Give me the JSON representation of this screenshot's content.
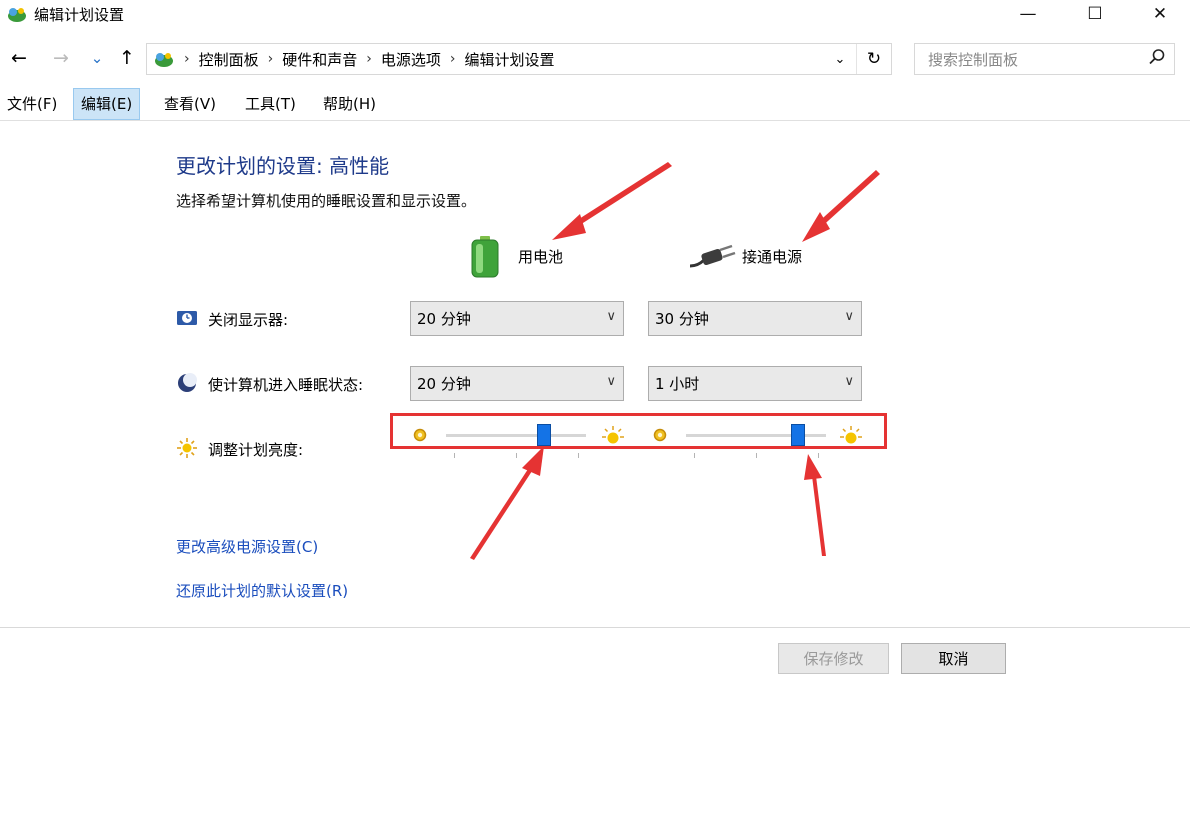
{
  "window": {
    "title": "编辑计划设置",
    "controls": {
      "minimize": "—",
      "maximize": "☐",
      "close": "✕"
    }
  },
  "nav": {
    "back": "←",
    "forward": "→",
    "recent": "⌄",
    "up": "↑",
    "breadcrumb": [
      "控制面板",
      "硬件和声音",
      "电源选项",
      "编辑计划设置"
    ],
    "separator": "›",
    "dropdown": "⌄",
    "refresh": "↻"
  },
  "search": {
    "placeholder": "搜索控制面板",
    "icon": "search-icon"
  },
  "menu": [
    "文件(F)",
    "编辑(E)",
    "查看(V)",
    "工具(T)",
    "帮助(H)"
  ],
  "menu_active_index": 1,
  "content": {
    "heading": "更改计划的设置: 高性能",
    "subheading": "选择希望计算机使用的睡眠设置和显示设置。",
    "col_battery": "用电池",
    "col_plugged": "接通电源",
    "rows": [
      {
        "label": "关闭显示器:",
        "battery": "20 分钟",
        "plugged": "30 分钟",
        "icon": "display-clock-icon"
      },
      {
        "label": "使计算机进入睡眠状态:",
        "battery": "20 分钟",
        "plugged": "1 小时",
        "icon": "moon-icon"
      }
    ],
    "brightness": {
      "label": "调整计划亮度:",
      "icon": "sun-icon",
      "battery_level": 0.72,
      "plugged_level": 0.83
    },
    "link_advanced": "更改高级电源设置(C)",
    "link_restore": "还原此计划的默认设置(R)"
  },
  "buttons": {
    "save": "保存修改",
    "cancel": "取消"
  },
  "colors": {
    "heading": "#1e3a8a",
    "link": "#1a4dbd",
    "annotation": "#e53333",
    "slider_thumb": "#1473e6",
    "menu_active": "#cce4f7"
  }
}
